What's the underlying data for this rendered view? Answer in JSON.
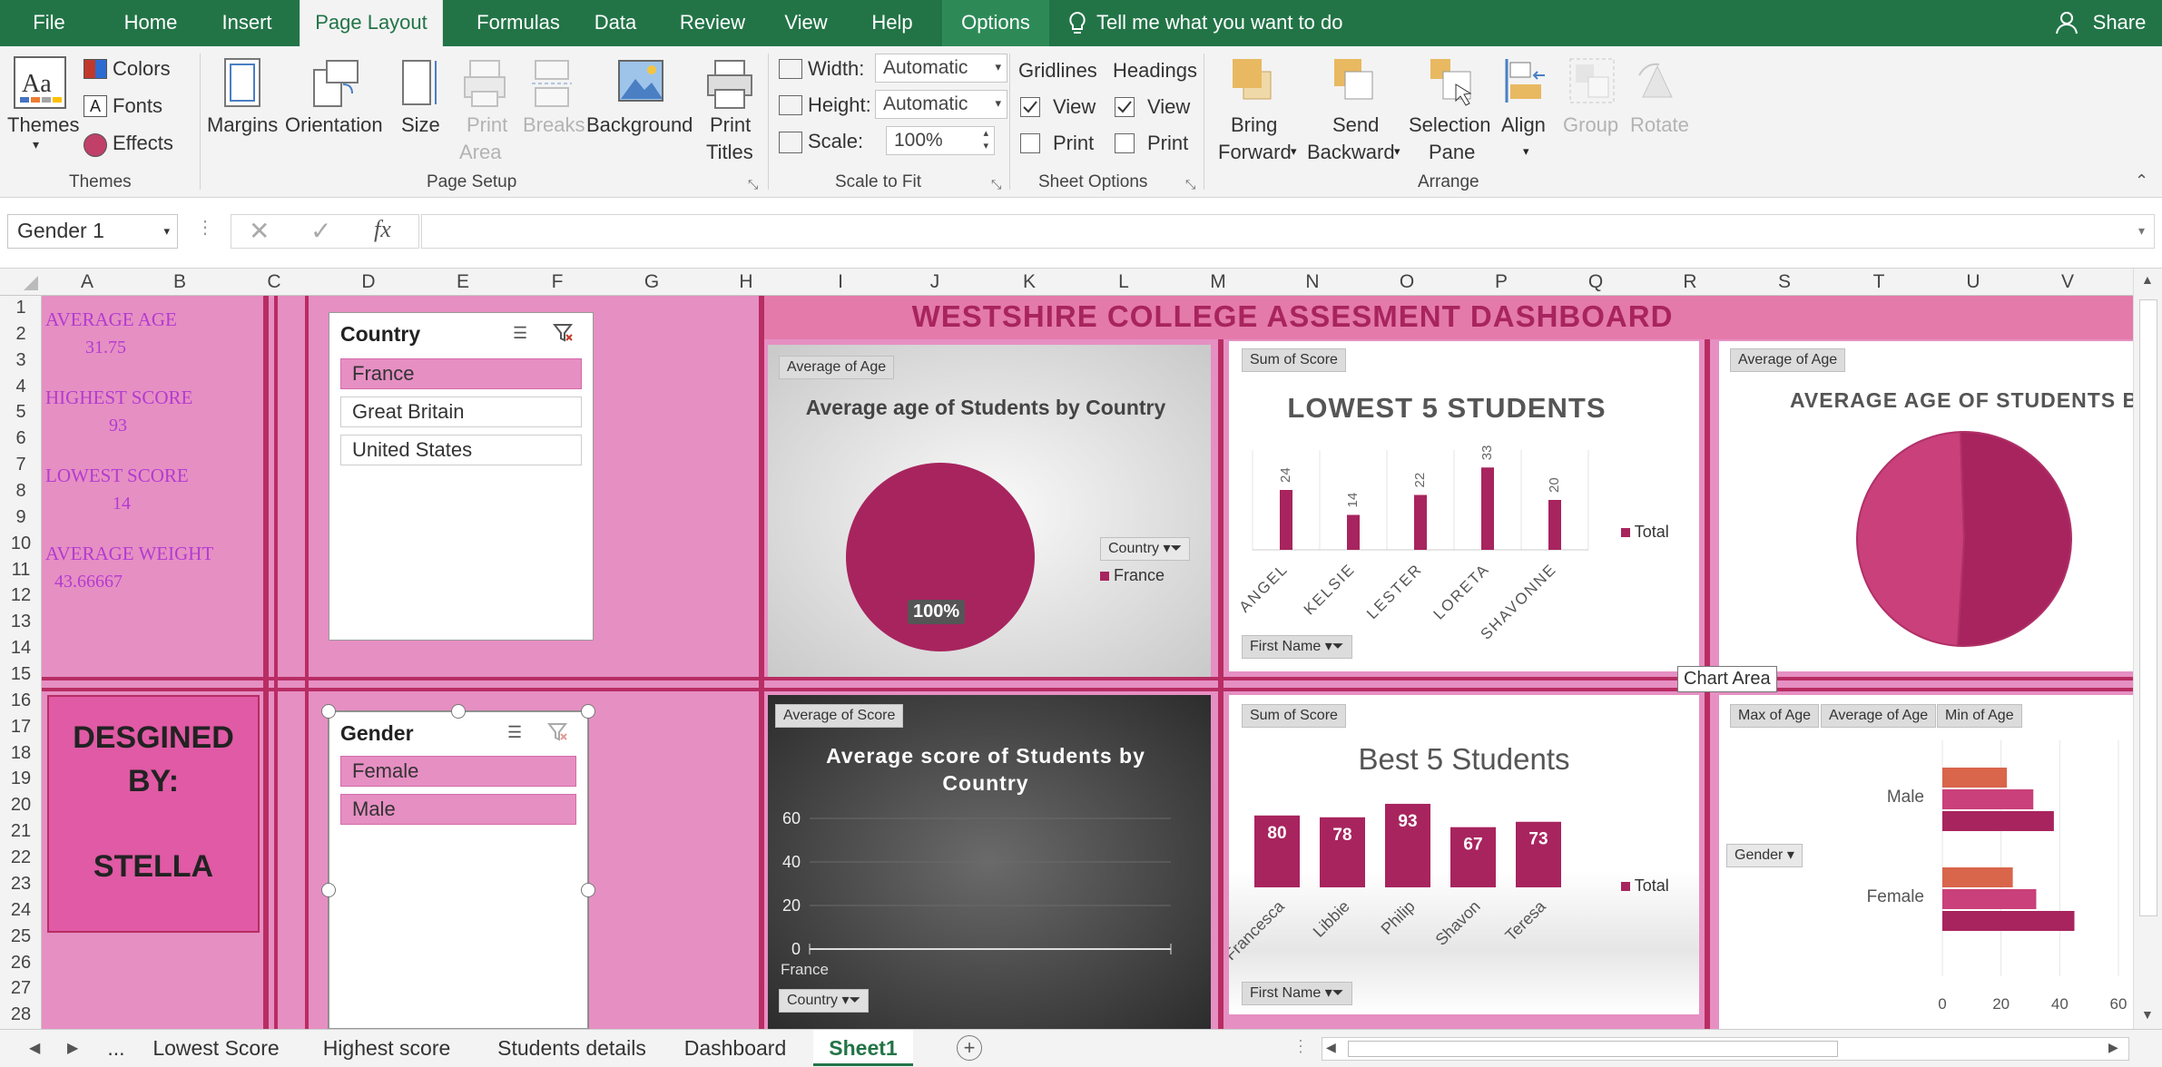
{
  "ribbon_tabs": [
    "File",
    "Home",
    "Insert",
    "Page Layout",
    "Formulas",
    "Data",
    "Review",
    "View",
    "Help",
    "Options"
  ],
  "tell_me": "Tell me what you want to do",
  "share": "Share",
  "ribbon": {
    "themes": {
      "themes": "Themes",
      "colors": "Colors",
      "fonts": "Fonts",
      "effects": "Effects",
      "group": "Themes"
    },
    "page_setup": {
      "margins": "Margins",
      "orientation": "Orientation",
      "size": "Size",
      "print_area_1": "Print",
      "print_area_2": "Area",
      "breaks": "Breaks",
      "background": "Background",
      "print_titles_1": "Print",
      "print_titles_2": "Titles",
      "group": "Page Setup"
    },
    "scale_to_fit": {
      "width_label": "Width:",
      "width_value": "Automatic",
      "height_label": "Height:",
      "height_value": "Automatic",
      "scale_label": "Scale:",
      "scale_value": "100%",
      "group": "Scale to Fit"
    },
    "sheet_options": {
      "gridlines": "Gridlines",
      "headings": "Headings",
      "view": "View",
      "print": "Print",
      "group": "Sheet Options"
    },
    "arrange": {
      "bring_1": "Bring",
      "bring_2": "Forward",
      "send_1": "Send",
      "send_2": "Backward",
      "selection_1": "Selection",
      "selection_2": "Pane",
      "align": "Align",
      "group_btn": "Group",
      "rotate": "Rotate",
      "group": "Arrange"
    }
  },
  "name_box": "Gender 1",
  "formula_value": "",
  "columns": [
    "A",
    "B",
    "C",
    "D",
    "E",
    "F",
    "G",
    "H",
    "I",
    "J",
    "K",
    "L",
    "M",
    "N",
    "O",
    "P",
    "Q",
    "R",
    "S",
    "T",
    "U",
    "V"
  ],
  "rows": [
    "1",
    "2",
    "3",
    "4",
    "5",
    "6",
    "7",
    "8",
    "9",
    "10",
    "11",
    "12",
    "13",
    "14",
    "15",
    "16",
    "17",
    "18",
    "19",
    "20",
    "21",
    "22",
    "23",
    "24",
    "25",
    "26",
    "27",
    "28"
  ],
  "stats": {
    "avg_age_label": "AVERAGE AGE",
    "avg_age_value": "31.75",
    "highest_label": "HIGHEST SCORE",
    "highest_value": "93",
    "lowest_label": "LOWEST SCORE",
    "lowest_value": "14",
    "avg_weight_label": "AVERAGE WEIGHT",
    "avg_weight_value": "43.66667"
  },
  "designer": {
    "line1": "DESGINED",
    "line2": "BY:",
    "line3": "STELLA"
  },
  "slicer_country": {
    "title": "Country",
    "items": [
      "France",
      "Great Britain",
      "United States"
    ],
    "selected": [
      true,
      false,
      false
    ]
  },
  "slicer_gender": {
    "title": "Gender",
    "items": [
      "Female",
      "Male"
    ],
    "selected": [
      true,
      true
    ]
  },
  "dashboard_title": "WESTSHIRE COLLEGE ASSESMENT DASHBOARD",
  "tooltip": "Chart Area",
  "colors": {
    "accent": "#a8245e",
    "pink": "#e68fc3",
    "green": "#227447",
    "orange": "#d9654b",
    "mid": "#c9407a"
  },
  "chart_data": [
    {
      "type": "pie",
      "title": "Average age of Students by Country",
      "field_button": "Average of Age",
      "filter_button": "Country",
      "legend": [
        "France"
      ],
      "values": [
        100
      ],
      "data_labels": [
        "100%"
      ]
    },
    {
      "type": "bar",
      "title": "LOWEST 5 STUDENTS",
      "field_button": "Sum of Score",
      "axis_button": "First Name",
      "categories": [
        "ANGEL",
        "KELSIE",
        "LESTER",
        "LORETA",
        "SHAVONNE"
      ],
      "values": [
        24,
        14,
        22,
        33,
        20
      ],
      "legend": [
        "Total"
      ]
    },
    {
      "type": "pie",
      "title": "AVERAGE AGE OF STUDENTS BY",
      "field_button": "Average of Age",
      "values": [
        48.5,
        51.5
      ]
    },
    {
      "type": "line",
      "title": "Average score of Students by Country",
      "field_button": "Average of Score",
      "filter_button": "Country",
      "categories": [
        "France"
      ],
      "ylim": [
        0,
        60
      ],
      "yticks": [
        "60",
        "40",
        "20",
        "0"
      ]
    },
    {
      "type": "bar",
      "title": "Best 5 Students",
      "field_button": "Sum of Score",
      "axis_button": "First Name",
      "categories": [
        "Francesca",
        "Libbie",
        "Philip",
        "Shavon",
        "Teresa"
      ],
      "values": [
        80,
        78,
        93,
        67,
        73
      ],
      "legend": [
        "Total"
      ]
    },
    {
      "type": "bar",
      "orientation": "horizontal",
      "field_buttons": [
        "Max of Age",
        "Average of Age",
        "Min of Age"
      ],
      "axis_button": "Gender",
      "categories": [
        "Male",
        "Female"
      ],
      "series": [
        {
          "values": [
            38,
            31,
            22
          ]
        },
        {
          "values": [
            45,
            32,
            24
          ]
        }
      ],
      "xlim": [
        0,
        60
      ],
      "xticks": [
        "0",
        "20",
        "40",
        "60"
      ]
    }
  ],
  "sheet_tabs": [
    "...",
    "Lowest Score",
    "Highest score",
    "Students details",
    "Dashboard",
    "Sheet1"
  ],
  "active_sheet": "Sheet1"
}
